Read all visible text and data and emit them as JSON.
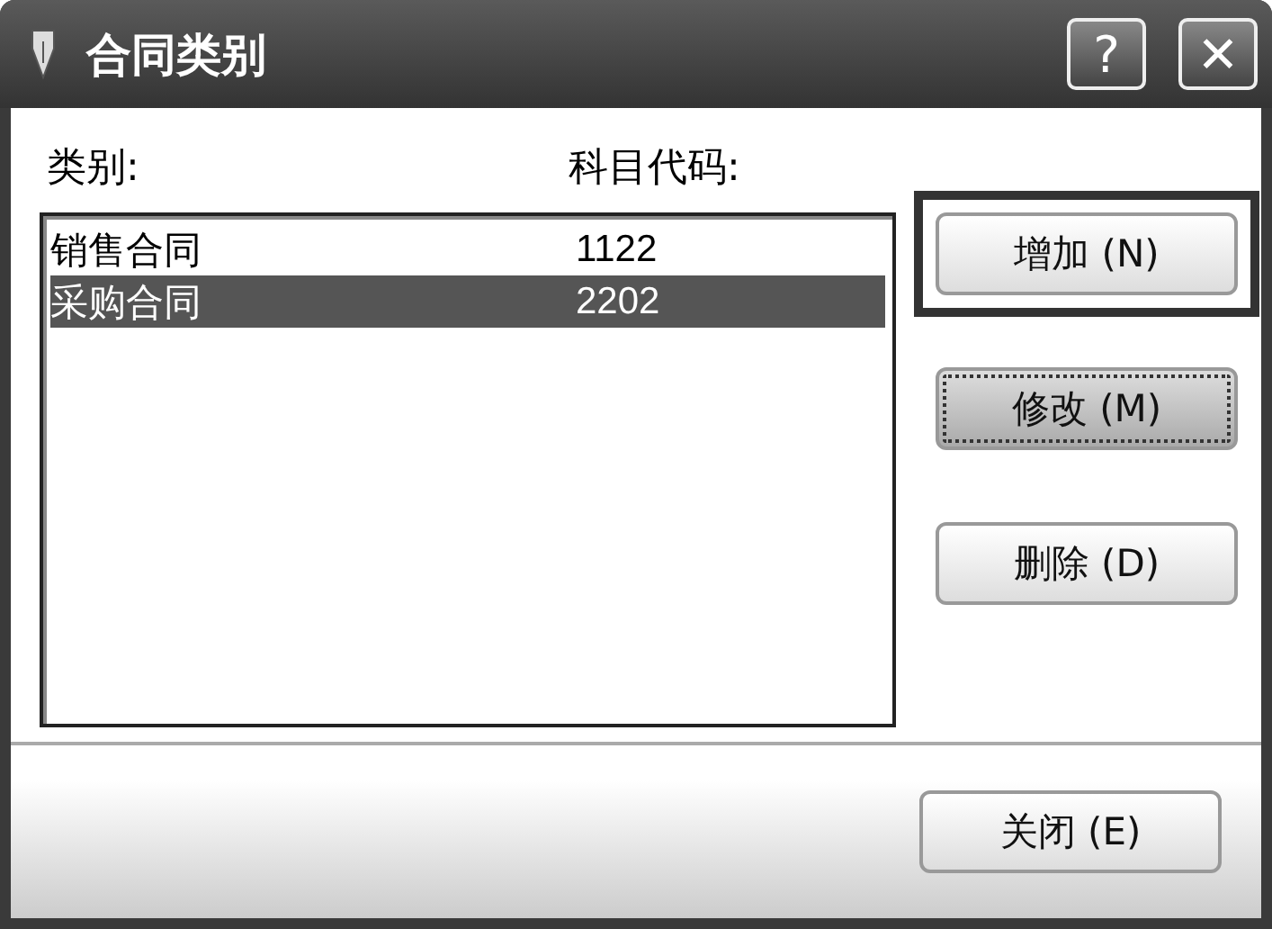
{
  "window": {
    "title": "合同类别",
    "buttons": [
      {
        "label": "?"
      },
      {
        "label": "✕"
      }
    ]
  },
  "columns": [
    "类别:",
    "科目代码:"
  ],
  "rows": [
    {
      "name": "销售合同",
      "code": "1122",
      "selected": false
    },
    {
      "name": "采购合同",
      "code": "2202",
      "selected": true
    }
  ],
  "buttons": [
    {
      "label": "增加 (N)",
      "default": true,
      "focused": false
    },
    {
      "label": "修改 (M)",
      "default": false,
      "focused": true
    },
    {
      "label": "删除 (D)",
      "default": false,
      "focused": false
    }
  ],
  "footer_buttons": [
    {
      "label": "关闭 (E)"
    }
  ]
}
